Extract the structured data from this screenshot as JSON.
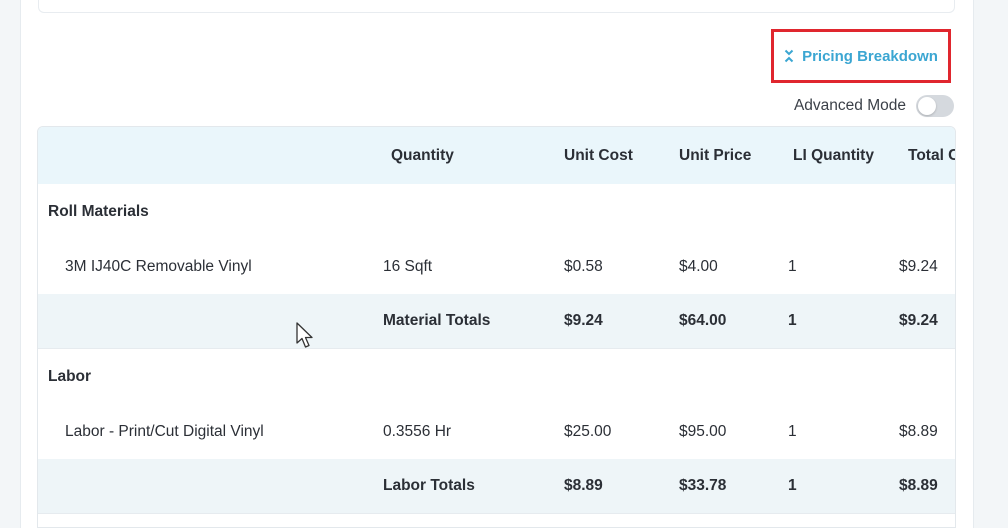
{
  "header": {
    "pricing_breakdown_label": "Pricing Breakdown",
    "advanced_mode_label": "Advanced Mode",
    "advanced_mode_enabled": false
  },
  "table": {
    "columns": [
      "",
      "Quantity",
      "Unit Cost",
      "Unit Price",
      "LI Quantity",
      "Total C"
    ],
    "sections": [
      {
        "title": "Roll Materials",
        "items": [
          {
            "name": "3M IJ40C Removable Vinyl",
            "quantity": "16 Sqft",
            "unit_cost": "$0.58",
            "unit_price": "$4.00",
            "li_quantity": "1",
            "total": "$9.24"
          }
        ],
        "totals": {
          "label": "Material Totals",
          "unit_cost": "$9.24",
          "unit_price": "$64.00",
          "li_quantity": "1",
          "total": "$9.24"
        }
      },
      {
        "title": "Labor",
        "items": [
          {
            "name": "Labor - Print/Cut Digital Vinyl",
            "quantity": "0.3556 Hr",
            "unit_cost": "$25.00",
            "unit_price": "$95.00",
            "li_quantity": "1",
            "total": "$8.89"
          }
        ],
        "totals": {
          "label": "Labor Totals",
          "unit_cost": "$8.89",
          "unit_price": "$33.78",
          "li_quantity": "1",
          "total": "$8.89"
        }
      }
    ]
  },
  "colors": {
    "accent": "#3ba6d2",
    "highlight_border": "#e0262e",
    "header_bg": "#eaf6fb",
    "totals_bg": "#eef5f8"
  },
  "icons": {
    "pricing_toggle": "collapse-chevrons-icon",
    "cursor": "mouse-pointer-icon"
  }
}
